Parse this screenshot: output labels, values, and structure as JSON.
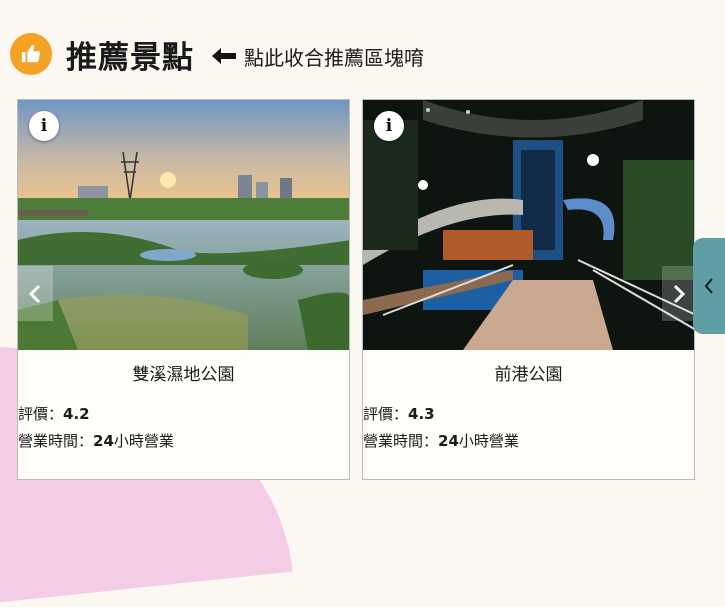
{
  "header": {
    "icon": "thumbs-up-icon",
    "title": "推薦景點",
    "hint": "點此收合推薦區塊唷"
  },
  "colors": {
    "badge": "#f4a223",
    "side_tab": "#5f9ea4",
    "background": "#fbf7f1",
    "blob": "#f3cde6"
  },
  "cards": [
    {
      "name": "雙溪濕地公園",
      "rating_label": "評價：",
      "rating_value": "4.2",
      "hours_label": "營業時間：",
      "hours_num": "24",
      "hours_unit": "小時營業",
      "info_icon": "i"
    },
    {
      "name": "前港公園",
      "rating_label": "評價：",
      "rating_value": "4.3",
      "hours_label": "營業時間：",
      "hours_num": "24",
      "hours_unit": "小時營業",
      "info_icon": "i"
    }
  ]
}
